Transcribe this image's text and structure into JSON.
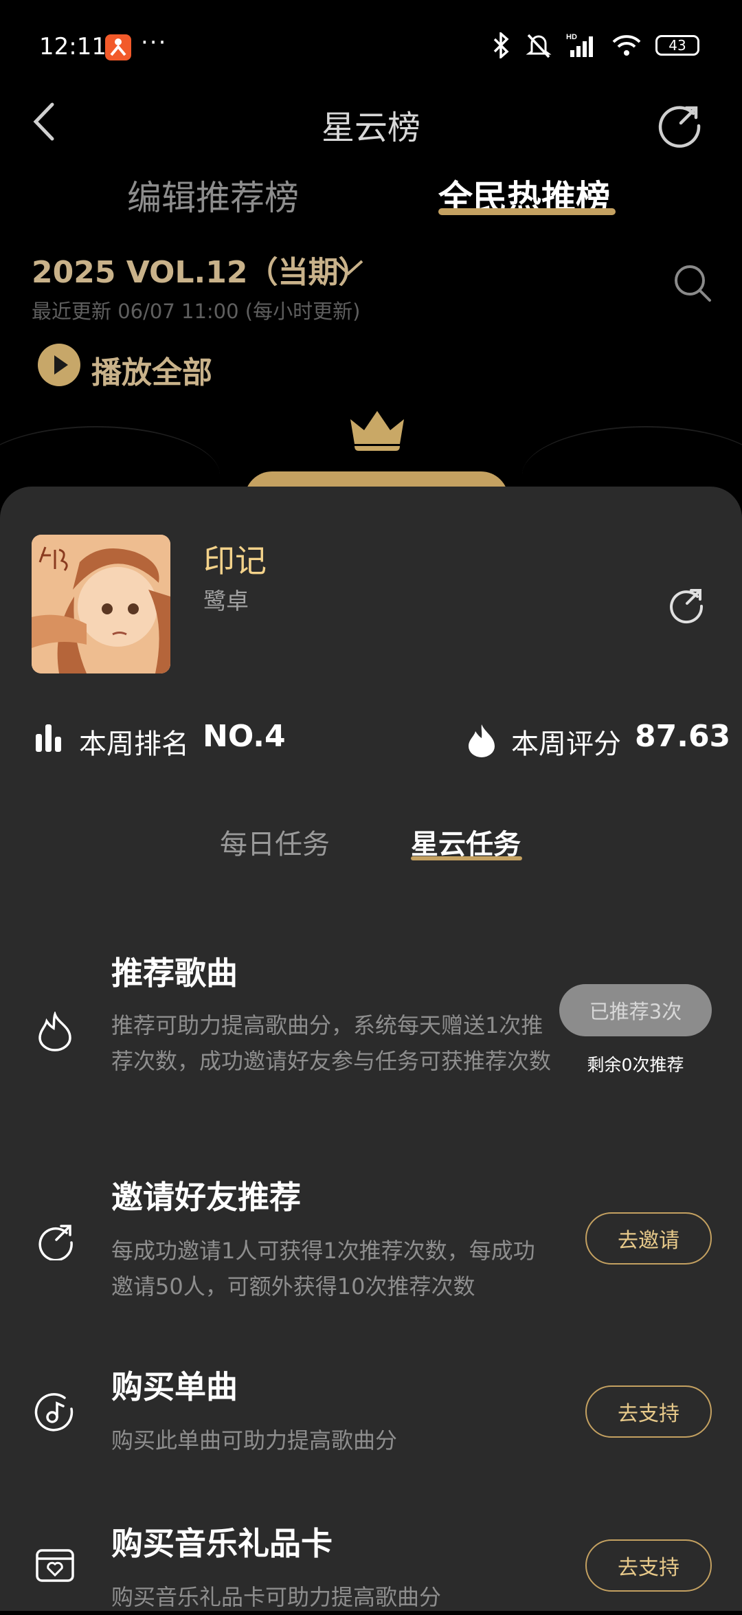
{
  "status_bar": {
    "time": "12:11",
    "more": "···",
    "battery": "43"
  },
  "header": {
    "title": "星云榜"
  },
  "tabs": {
    "editor": "编辑推荐榜",
    "public": "全民热推榜"
  },
  "period": {
    "label": "2025 VOL.12（当期）",
    "update": "最近更新 06/07 11:00 (每小时更新)"
  },
  "play_all": "播放全部",
  "song": {
    "title": "印记",
    "artist": "鹭卓"
  },
  "stats": {
    "rank_label": "本周排名",
    "rank_value": "NO.4",
    "score_label": "本周评分",
    "score_value": "87.63"
  },
  "task_tabs": {
    "daily": "每日任务",
    "star": "星云任务"
  },
  "tasks": [
    {
      "title": "推荐歌曲",
      "desc": "推荐可助力提高歌曲分，系统每天赠送1次推荐次数，成功邀请好友参与任务可获推荐次数",
      "button": "已推荐3次",
      "note": "剩余0次推荐",
      "icon": "flame-outline-icon"
    },
    {
      "title": "邀请好友推荐",
      "desc": "每成功邀请1人可获得1次推荐次数，每成功邀请50人，可额外获得10次推荐次数",
      "button": "去邀请",
      "icon": "share-arrow-icon"
    },
    {
      "title": "购买单曲",
      "desc": "购买此单曲可助力提高歌曲分",
      "button": "去支持",
      "icon": "music-note-icon"
    },
    {
      "title": "购买音乐礼品卡",
      "desc": "购买音乐礼品卡可助力提高歌曲分",
      "button": "去支持",
      "icon": "gift-card-icon"
    }
  ],
  "colors": {
    "gold": "#c4a161",
    "gold_text": "#c9b28a",
    "sheet_bg": "#2b2b2b",
    "song_title": "#f3d28a"
  }
}
